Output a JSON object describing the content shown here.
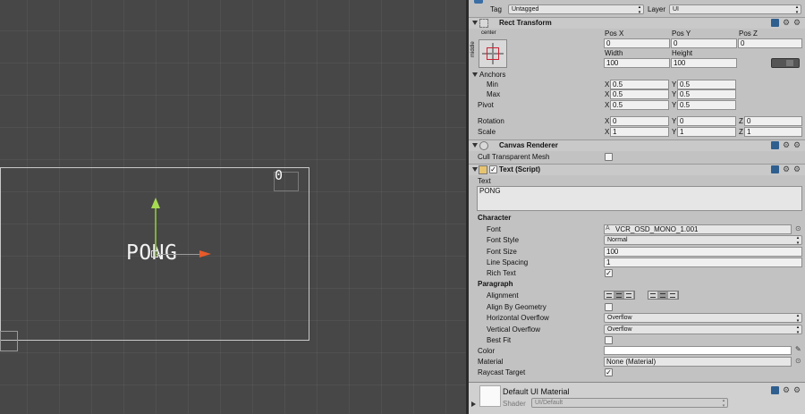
{
  "scene": {
    "score_text": "0",
    "title_text": "PONG"
  },
  "top": {
    "tag_label": "Tag",
    "tag_value": "Untagged",
    "layer_label": "Layer",
    "layer_value": "UI"
  },
  "rect_transform": {
    "title": "Rect Transform",
    "anchor_preset_h": "center",
    "anchor_preset_v": "middle",
    "pos_x_label": "Pos X",
    "pos_y_label": "Pos Y",
    "pos_z_label": "Pos Z",
    "pos_x": "0",
    "pos_y": "0",
    "pos_z": "0",
    "width_label": "Width",
    "height_label": "Height",
    "width": "100",
    "height": "100",
    "anchors_label": "Anchors",
    "min_label": "Min",
    "max_label": "Max",
    "pivot_label": "Pivot",
    "x_label": "X",
    "y_label": "Y",
    "z_label": "Z",
    "min_x": "0.5",
    "min_y": "0.5",
    "max_x": "0.5",
    "max_y": "0.5",
    "pivot_x": "0.5",
    "pivot_y": "0.5",
    "rotation_label": "Rotation",
    "rot_x": "0",
    "rot_y": "0",
    "rot_z": "0",
    "scale_label": "Scale",
    "scale_x": "1",
    "scale_y": "1",
    "scale_z": "1"
  },
  "canvas_renderer": {
    "title": "Canvas Renderer",
    "cull_label": "Cull Transparent Mesh"
  },
  "text_script": {
    "title": "Text (Script)",
    "text_label": "Text",
    "text_value": "PONG",
    "character_label": "Character",
    "font_label": "Font",
    "font_value": "VCR_OSD_MONO_1.001",
    "font_style_label": "Font Style",
    "font_style_value": "Normal",
    "font_size_label": "Font Size",
    "font_size_value": "100",
    "line_spacing_label": "Line Spacing",
    "line_spacing_value": "1",
    "rich_text_label": "Rich Text",
    "paragraph_label": "Paragraph",
    "alignment_label": "Alignment",
    "align_geometry_label": "Align By Geometry",
    "h_overflow_label": "Horizontal Overflow",
    "h_overflow_value": "Overflow",
    "v_overflow_label": "Vertical Overflow",
    "v_overflow_value": "Overflow",
    "best_fit_label": "Best Fit",
    "color_label": "Color",
    "color_value": "#ffffff",
    "material_label": "Material",
    "material_value": "None (Material)",
    "raycast_label": "Raycast Target"
  },
  "material_footer": {
    "title": "Default UI Material",
    "shader_label": "Shader",
    "shader_value": "UI/Default"
  },
  "icons": {
    "check": "✓",
    "gear": "⚙",
    "target": "⊙",
    "picker": "✎"
  }
}
